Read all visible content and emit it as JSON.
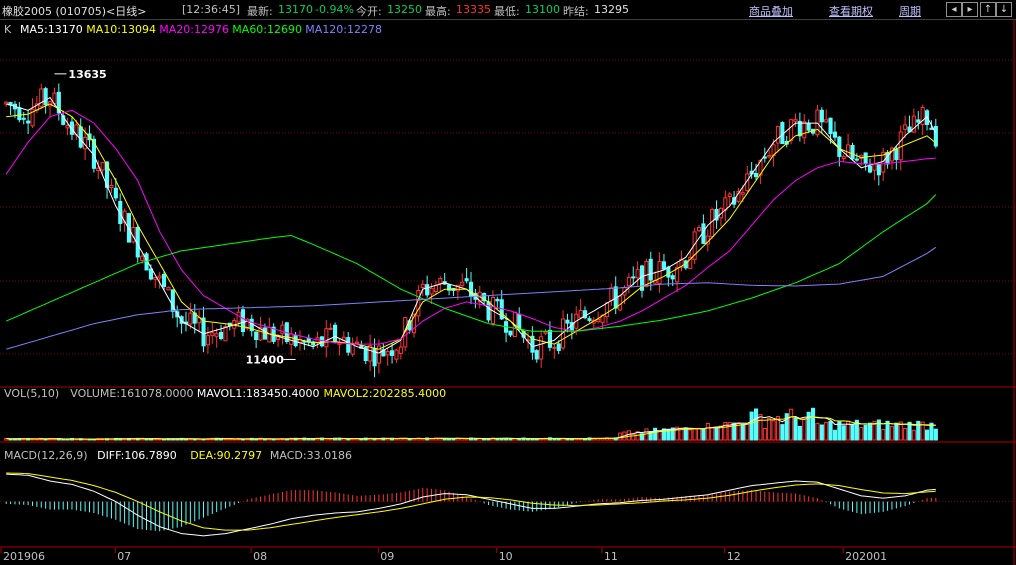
{
  "header": {
    "title": "橡胶2005 (010705)<日线>",
    "time": "[12:36:45]",
    "latest_label": "最新:",
    "latest_value": "13170",
    "change": "-0.94%",
    "open_label": "今开:",
    "open_value": "13250",
    "high_label": "最高:",
    "high_value": "13335",
    "low_label": "最低:",
    "low_value": "13100",
    "prev_label": "昨结:",
    "prev_value": "13295",
    "menu": [
      "商品叠加",
      "查看期权",
      "周期"
    ],
    "nav_icons": [
      "arrow-left-icon",
      "arrow-right-icon",
      "zoom-in-icon",
      "zoom-out-icon"
    ]
  },
  "chart_data": {
    "type": "candlestick",
    "price_panel": {
      "prefix": "K",
      "legend": [
        {
          "text": "MA5:13170",
          "color": "#ffffff"
        },
        {
          "text": "MA10:13094",
          "color": "#ffff00"
        },
        {
          "text": "MA20:12976",
          "color": "#ff00ff"
        },
        {
          "text": "MA60:12690",
          "color": "#00ff00"
        },
        {
          "text": "MA120:12278",
          "color": "#8080ff"
        }
      ],
      "ylim": [
        11200,
        13900
      ],
      "high_annotation": "13635",
      "low_annotation": "11400",
      "ma_series": [
        {
          "name": "MA5",
          "color": "#ffffff",
          "points": [
            [
              0,
              13400
            ],
            [
              5,
              13350
            ],
            [
              10,
              13450
            ],
            [
              15,
              13200
            ],
            [
              20,
              13000
            ],
            [
              25,
              12600
            ],
            [
              30,
              12300
            ],
            [
              35,
              12000
            ],
            [
              40,
              11700
            ],
            [
              45,
              11600
            ],
            [
              50,
              11650
            ],
            [
              55,
              11700
            ],
            [
              60,
              11600
            ],
            [
              65,
              11550
            ],
            [
              70,
              11500
            ],
            [
              75,
              11580
            ],
            [
              80,
              11500
            ],
            [
              85,
              11450
            ],
            [
              90,
              11550
            ],
            [
              95,
              11950
            ],
            [
              100,
              12000
            ],
            [
              105,
              11950
            ],
            [
              110,
              11800
            ],
            [
              115,
              11700
            ],
            [
              120,
              11500
            ],
            [
              125,
              11550
            ],
            [
              130,
              11700
            ],
            [
              135,
              11800
            ],
            [
              140,
              11900
            ],
            [
              145,
              12050
            ],
            [
              150,
              12100
            ],
            [
              155,
              12200
            ],
            [
              160,
              12450
            ],
            [
              165,
              12600
            ],
            [
              170,
              12850
            ],
            [
              175,
              13100
            ],
            [
              180,
              13250
            ],
            [
              185,
              13250
            ],
            [
              190,
              13050
            ],
            [
              195,
              12900
            ],
            [
              200,
              12950
            ],
            [
              205,
              13150
            ],
            [
              210,
              13300
            ],
            [
              212,
              13170
            ]
          ]
        },
        {
          "name": "MA10",
          "color": "#ffff00",
          "points": [
            [
              0,
              13300
            ],
            [
              5,
              13320
            ],
            [
              10,
              13400
            ],
            [
              15,
              13300
            ],
            [
              20,
              13100
            ],
            [
              25,
              12800
            ],
            [
              30,
              12450
            ],
            [
              35,
              12150
            ],
            [
              40,
              11850
            ],
            [
              45,
              11700
            ],
            [
              50,
              11680
            ],
            [
              55,
              11650
            ],
            [
              60,
              11600
            ],
            [
              65,
              11570
            ],
            [
              70,
              11530
            ],
            [
              75,
              11540
            ],
            [
              80,
              11520
            ],
            [
              85,
              11480
            ],
            [
              90,
              11560
            ],
            [
              95,
              11850
            ],
            [
              100,
              11950
            ],
            [
              105,
              11950
            ],
            [
              110,
              11850
            ],
            [
              115,
              11700
            ],
            [
              120,
              11560
            ],
            [
              125,
              11520
            ],
            [
              130,
              11620
            ],
            [
              135,
              11720
            ],
            [
              140,
              11830
            ],
            [
              145,
              11970
            ],
            [
              150,
              12050
            ],
            [
              155,
              12150
            ],
            [
              160,
              12320
            ],
            [
              165,
              12500
            ],
            [
              170,
              12750
            ],
            [
              175,
              13000
            ],
            [
              180,
              13150
            ],
            [
              185,
              13200
            ],
            [
              190,
              13050
            ],
            [
              195,
              12980
            ],
            [
              200,
              13000
            ],
            [
              205,
              13080
            ],
            [
              210,
              13150
            ],
            [
              212,
              13094
            ]
          ]
        },
        {
          "name": "MA20",
          "color": "#ff00ff",
          "points": [
            [
              0,
              12850
            ],
            [
              5,
              13100
            ],
            [
              10,
              13300
            ],
            [
              15,
              13350
            ],
            [
              20,
              13250
            ],
            [
              25,
              13050
            ],
            [
              30,
              12800
            ],
            [
              35,
              12400
            ],
            [
              40,
              12100
            ],
            [
              45,
              11900
            ],
            [
              50,
              11800
            ],
            [
              55,
              11700
            ],
            [
              60,
              11650
            ],
            [
              65,
              11600
            ],
            [
              70,
              11560
            ],
            [
              75,
              11530
            ],
            [
              80,
              11520
            ],
            [
              85,
              11520
            ],
            [
              90,
              11560
            ],
            [
              95,
              11700
            ],
            [
              100,
              11800
            ],
            [
              105,
              11850
            ],
            [
              110,
              11820
            ],
            [
              115,
              11780
            ],
            [
              120,
              11720
            ],
            [
              125,
              11650
            ],
            [
              130,
              11620
            ],
            [
              135,
              11650
            ],
            [
              140,
              11700
            ],
            [
              145,
              11780
            ],
            [
              150,
              11880
            ],
            [
              155,
              11980
            ],
            [
              160,
              12120
            ],
            [
              165,
              12250
            ],
            [
              170,
              12450
            ],
            [
              175,
              12650
            ],
            [
              180,
              12800
            ],
            [
              185,
              12900
            ],
            [
              190,
              12950
            ],
            [
              195,
              12930
            ],
            [
              200,
              12930
            ],
            [
              205,
              12950
            ],
            [
              210,
              12970
            ],
            [
              212,
              12976
            ]
          ]
        },
        {
          "name": "MA60",
          "color": "#00ff00",
          "points": [
            [
              0,
              11700
            ],
            [
              10,
              11850
            ],
            [
              20,
              12000
            ],
            [
              30,
              12150
            ],
            [
              40,
              12250
            ],
            [
              50,
              12300
            ],
            [
              60,
              12350
            ],
            [
              65,
              12370
            ],
            [
              70,
              12300
            ],
            [
              80,
              12150
            ],
            [
              90,
              11950
            ],
            [
              100,
              11800
            ],
            [
              110,
              11680
            ],
            [
              120,
              11620
            ],
            [
              130,
              11620
            ],
            [
              140,
              11660
            ],
            [
              150,
              11710
            ],
            [
              160,
              11780
            ],
            [
              170,
              11880
            ],
            [
              180,
              12000
            ],
            [
              190,
              12150
            ],
            [
              200,
              12400
            ],
            [
              210,
              12620
            ],
            [
              212,
              12690
            ]
          ]
        },
        {
          "name": "MA120",
          "color": "#8080ff",
          "points": [
            [
              0,
              11480
            ],
            [
              10,
              11580
            ],
            [
              20,
              11680
            ],
            [
              30,
              11750
            ],
            [
              40,
              11790
            ],
            [
              50,
              11800
            ],
            [
              60,
              11810
            ],
            [
              70,
              11820
            ],
            [
              80,
              11840
            ],
            [
              90,
              11860
            ],
            [
              100,
              11880
            ],
            [
              110,
              11900
            ],
            [
              120,
              11920
            ],
            [
              130,
              11940
            ],
            [
              140,
              11960
            ],
            [
              150,
              11990
            ],
            [
              160,
              12000
            ],
            [
              170,
              11980
            ],
            [
              180,
              11975
            ],
            [
              190,
              11990
            ],
            [
              200,
              12050
            ],
            [
              210,
              12230
            ],
            [
              212,
              12278
            ]
          ]
        }
      ]
    },
    "volume_panel": {
      "legend": [
        {
          "text": "VOL(5,10)",
          "color": "#c0c0c0"
        },
        {
          "text": "VOLUME:161078.0000",
          "color": "#c0c0c0"
        },
        {
          "text": "MAVOL1:183450.4000",
          "color": "#ffffff"
        },
        {
          "text": "MAVOL2:202285.4000",
          "color": "#ffff00"
        }
      ],
      "ylim": [
        0,
        420000
      ]
    },
    "macd_panel": {
      "legend": [
        {
          "text": "MACD(12,26,9)",
          "color": "#c0c0c0"
        },
        {
          "text": "DIFF:106.7890",
          "color": "#ffffff"
        },
        {
          "text": "DEA:90.2797",
          "color": "#ffff00"
        },
        {
          "text": "MACD:33.0186",
          "color": "#c0c0c0"
        }
      ],
      "ylim": [
        -380,
        320
      ],
      "diff_points": [
        [
          0,
          240
        ],
        [
          5,
          230
        ],
        [
          10,
          180
        ],
        [
          15,
          150
        ],
        [
          20,
          90
        ],
        [
          25,
          0
        ],
        [
          30,
          -120
        ],
        [
          35,
          -220
        ],
        [
          40,
          -280
        ],
        [
          45,
          -300
        ],
        [
          50,
          -280
        ],
        [
          55,
          -240
        ],
        [
          60,
          -200
        ],
        [
          65,
          -150
        ],
        [
          70,
          -120
        ],
        [
          75,
          -100
        ],
        [
          80,
          -90
        ],
        [
          85,
          -60
        ],
        [
          90,
          -20
        ],
        [
          95,
          40
        ],
        [
          100,
          70
        ],
        [
          105,
          60
        ],
        [
          110,
          20
        ],
        [
          115,
          -20
        ],
        [
          120,
          -60
        ],
        [
          125,
          -60
        ],
        [
          130,
          -40
        ],
        [
          135,
          -20
        ],
        [
          140,
          -10
        ],
        [
          145,
          10
        ],
        [
          150,
          20
        ],
        [
          155,
          40
        ],
        [
          160,
          60
        ],
        [
          165,
          100
        ],
        [
          170,
          140
        ],
        [
          175,
          160
        ],
        [
          180,
          180
        ],
        [
          185,
          170
        ],
        [
          190,
          110
        ],
        [
          195,
          50
        ],
        [
          200,
          30
        ],
        [
          205,
          50
        ],
        [
          210,
          100
        ],
        [
          212,
          106.8
        ]
      ],
      "dea_points": [
        [
          0,
          250
        ],
        [
          5,
          245
        ],
        [
          10,
          215
        ],
        [
          15,
          185
        ],
        [
          20,
          140
        ],
        [
          25,
          80
        ],
        [
          30,
          0
        ],
        [
          35,
          -90
        ],
        [
          40,
          -170
        ],
        [
          45,
          -230
        ],
        [
          50,
          -250
        ],
        [
          55,
          -250
        ],
        [
          60,
          -230
        ],
        [
          65,
          -200
        ],
        [
          70,
          -170
        ],
        [
          75,
          -140
        ],
        [
          80,
          -115
        ],
        [
          85,
          -90
        ],
        [
          90,
          -60
        ],
        [
          95,
          -20
        ],
        [
          100,
          20
        ],
        [
          105,
          40
        ],
        [
          110,
          35
        ],
        [
          115,
          15
        ],
        [
          120,
          -15
        ],
        [
          125,
          -30
        ],
        [
          130,
          -35
        ],
        [
          135,
          -30
        ],
        [
          140,
          -20
        ],
        [
          145,
          -10
        ],
        [
          150,
          5
        ],
        [
          155,
          15
        ],
        [
          160,
          30
        ],
        [
          165,
          55
        ],
        [
          170,
          90
        ],
        [
          175,
          120
        ],
        [
          180,
          145
        ],
        [
          185,
          155
        ],
        [
          190,
          140
        ],
        [
          195,
          105
        ],
        [
          200,
          75
        ],
        [
          205,
          70
        ],
        [
          210,
          85
        ],
        [
          212,
          90.3
        ]
      ]
    },
    "x_labels": [
      {
        "text": "201906",
        "index": 0
      },
      {
        "text": "07",
        "index": 26
      },
      {
        "text": "08",
        "index": 57
      },
      {
        "text": "09",
        "index": 86
      },
      {
        "text": "10",
        "index": 113
      },
      {
        "text": "11",
        "index": 137
      },
      {
        "text": "12",
        "index": 165
      },
      {
        "text": "202001",
        "index": 192
      }
    ],
    "bar_count": 213
  }
}
